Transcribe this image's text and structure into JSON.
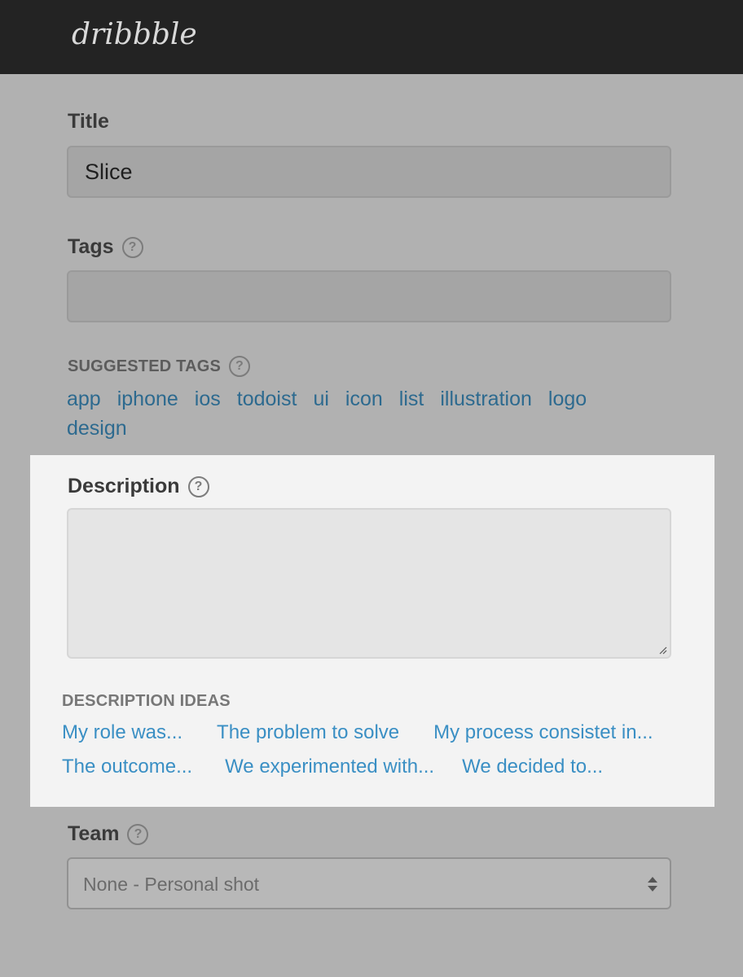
{
  "header": {
    "logo_text": "dribbble"
  },
  "form": {
    "title": {
      "label": "Title",
      "value": "Slice"
    },
    "tags": {
      "label": "Tags",
      "help": "?",
      "value": ""
    },
    "suggested_tags": {
      "label": "SUGGESTED TAGS",
      "help": "?",
      "items": [
        "app",
        "iphone",
        "ios",
        "todoist",
        "ui",
        "icon",
        "list",
        "illustration",
        "logo",
        "design"
      ]
    },
    "description": {
      "label": "Description",
      "help": "?",
      "value": ""
    },
    "description_ideas": {
      "label": "DESCRIPTION IDEAS",
      "items": [
        "My role was...",
        "The problem to solve",
        "My process consistet in...",
        "The outcome...",
        "We experimented with...",
        "We decided to..."
      ]
    },
    "team": {
      "label": "Team",
      "help": "?",
      "selected": "None - Personal shot"
    }
  },
  "colors": {
    "topbar": "#232323",
    "page_bg": "#b1b1b1",
    "panel_bg": "#f3f3f3",
    "tag_link": "#2d6a8f",
    "idea_link": "#3a8fc4"
  },
  "icons": {
    "help": "question-circle-icon",
    "resize": "resize-handle-icon",
    "select": "updown-arrows-icon"
  }
}
